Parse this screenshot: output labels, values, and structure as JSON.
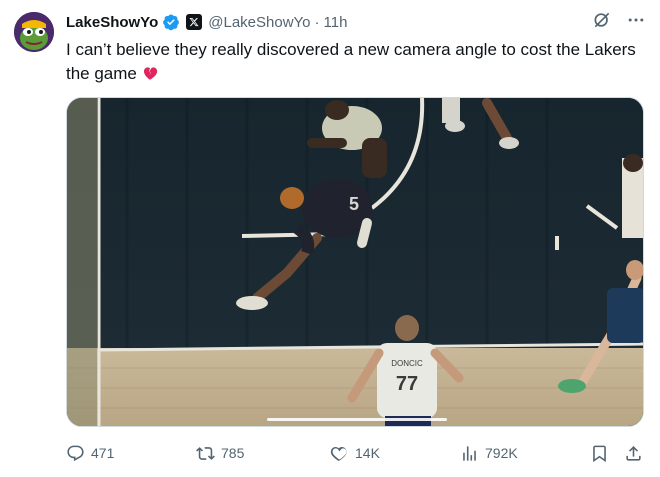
{
  "author": {
    "display_name": "LakeShowYo",
    "handle": "@LakeShowYo",
    "separator": "·",
    "time": "11h"
  },
  "tweet": {
    "text": "I can’t believe they really discovered a new camera angle to cost the Lakers the game"
  },
  "media": {
    "jersey_number": "77",
    "jersey_name": "DONCIC"
  },
  "actions": {
    "reply_count": "471",
    "retweet_count": "785",
    "like_count": "14K",
    "view_count": "792K"
  },
  "icons": {
    "verified": "verified-badge-icon",
    "x_badge": "x-logo-icon",
    "grok": "grok-icon",
    "more": "more-icon",
    "reply": "reply-icon",
    "retweet": "retweet-icon",
    "like": "heart-icon",
    "views": "views-icon",
    "bookmark": "bookmark-icon",
    "share": "share-icon",
    "emoji": "broken-heart-emoji"
  },
  "colors": {
    "verified_blue": "#1d9bf0",
    "text_primary": "#0f1419",
    "text_secondary": "#536471",
    "broken_heart": "#e0245e"
  }
}
